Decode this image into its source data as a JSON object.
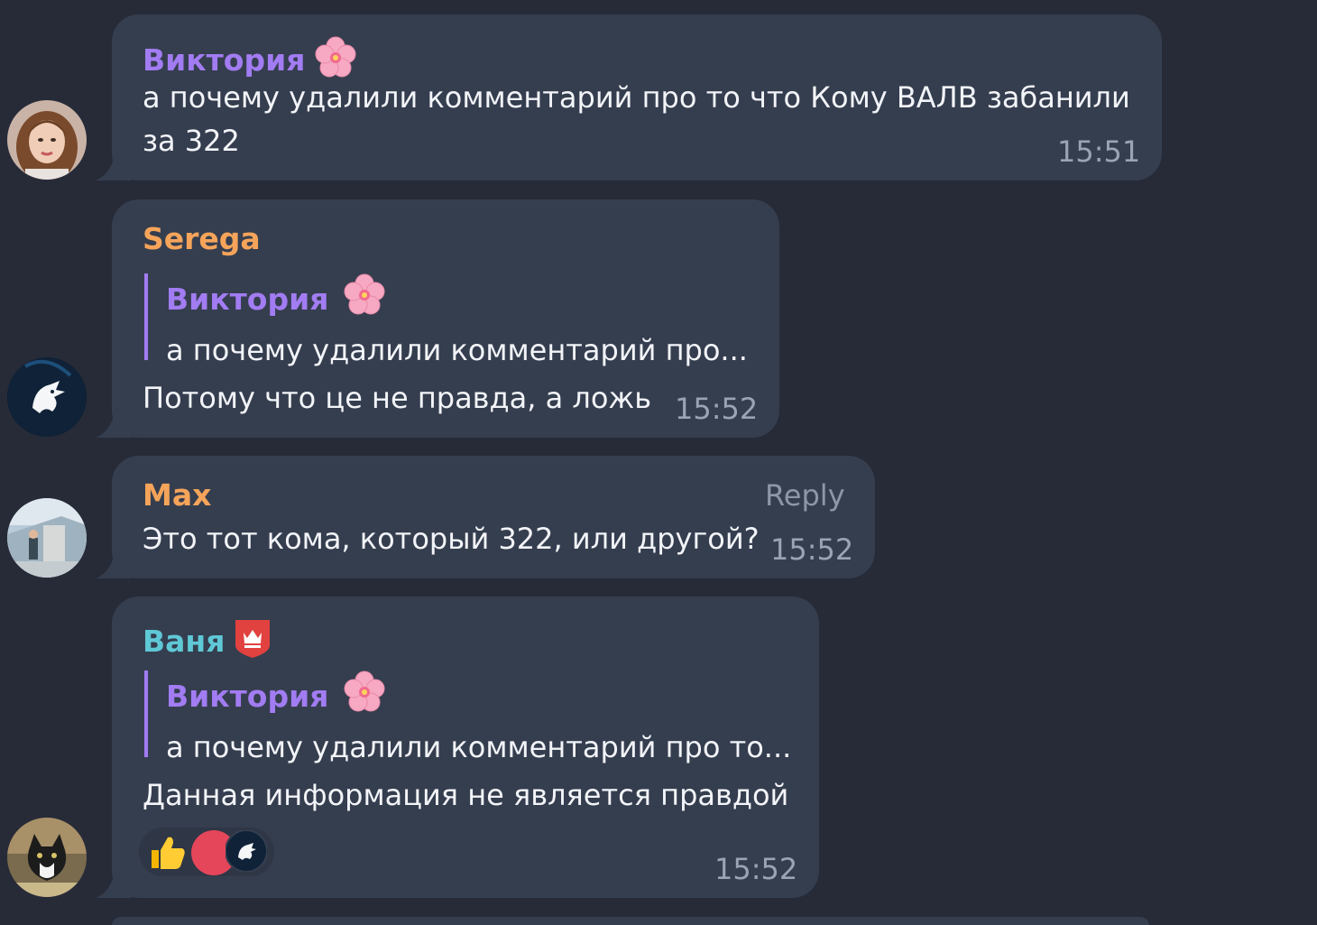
{
  "colors": {
    "background": "#272b38",
    "bubble": "#353e4f",
    "name_viktoria": "#a27cf2",
    "name_serega": "#f5a45a",
    "name_max": "#f5a45a",
    "name_vanya": "#5fc8d6",
    "admin_badge": "#e1413f",
    "time": "#9aa4b3",
    "message_text": "#f2f4f8",
    "reaction_red": "#e5465a"
  },
  "messages": [
    {
      "author": "Виктория",
      "author_icon": "cherry-blossom-icon",
      "text_line1": "а почему удалили комментарий про то что Кому ВАЛВ забанили",
      "text_line2": "за 322",
      "time": "15:51",
      "avatar": "avatar-photo-viktoria"
    },
    {
      "author": "Serega",
      "quote": {
        "author": "Виктория",
        "author_icon": "cherry-blossom-icon",
        "text": "а почему удалили комментарий про..."
      },
      "text": "Потому что це не правда, а ложь",
      "time": "15:52",
      "avatar": "dragon-logo-avatar"
    },
    {
      "author": "Max",
      "reply_label": "Reply",
      "text": "Это тот кома, который 322, или другой?",
      "time": "15:52",
      "avatar": "avatar-photo-max"
    },
    {
      "author": "Ваня",
      "author_icon": "admin-crown-badge-icon",
      "quote": {
        "author": "Виктория",
        "author_icon": "cherry-blossom-icon",
        "text": "а почему удалили комментарий про то..."
      },
      "text": "Данная информация не является правдой",
      "reactions": [
        "thumbs-up-icon",
        "red-circle-reaction",
        "dragon-avatar-reaction"
      ],
      "time": "15:52",
      "avatar": "avatar-photo-vanya"
    }
  ]
}
